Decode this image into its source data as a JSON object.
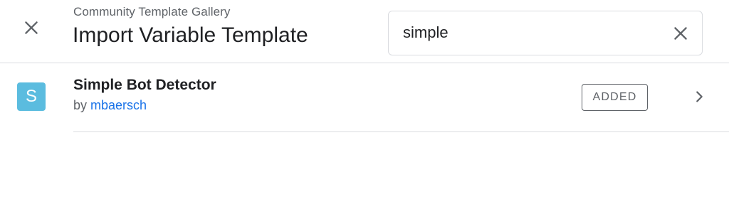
{
  "header": {
    "subtitle": "Community Template Gallery",
    "title": "Import Variable Template",
    "close_icon": "close-icon"
  },
  "search": {
    "value": "simple",
    "placeholder": "",
    "clear_icon": "close-icon"
  },
  "results": [
    {
      "avatar_letter": "S",
      "avatar_color": "#5bbcdf",
      "name": "Simple Bot Detector",
      "by_prefix": "by",
      "author": "mbaersch",
      "badge": "ADDED",
      "chevron_icon": "chevron-right-icon"
    }
  ],
  "colors": {
    "accent_link": "#1a73e8",
    "divider": "#dadce0",
    "secondary_text": "#5f6368"
  }
}
